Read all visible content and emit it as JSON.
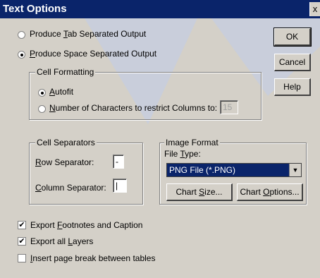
{
  "dialog": {
    "title": "Text Options",
    "close_glyph": "x"
  },
  "output": {
    "tab_label_pre": "Produce ",
    "tab_label_u": "T",
    "tab_label_post": "ab Separated Output",
    "space_label_u": "P",
    "space_label_post": "roduce Space Separated Output",
    "selected": "space"
  },
  "buttons": {
    "ok": "OK",
    "cancel": "Cancel",
    "help": "Help"
  },
  "cell_formatting": {
    "title": "Cell Formatting",
    "autofit_u": "A",
    "autofit_post": "utofit",
    "numchars_u": "N",
    "numchars_post": "umber of Characters to restrict Columns to:",
    "numchars_value": "15",
    "selected": "autofit"
  },
  "cell_separators": {
    "title": "Cell Separators",
    "row_u": "R",
    "row_post": "ow Separator:",
    "row_value": "-",
    "col_u": "C",
    "col_post": "olumn Separator:",
    "col_value": "|"
  },
  "image_format": {
    "title": "Image Format",
    "file_type_pre": "File ",
    "file_type_u": "T",
    "file_type_post": "ype:",
    "selected_type": "PNG File (*.PNG)",
    "chart_size_pre": "Chart ",
    "chart_size_u": "S",
    "chart_size_post": "ize...",
    "chart_options_pre": "Chart ",
    "chart_options_u": "O",
    "chart_options_post": "ptions..."
  },
  "options": {
    "footnotes_pre": "Export ",
    "footnotes_u": "F",
    "footnotes_post": "ootnotes and Caption",
    "footnotes_checked": true,
    "layers_pre": "Export all ",
    "layers_u": "L",
    "layers_post": "ayers",
    "layers_checked": true,
    "pagebreak_u": "I",
    "pagebreak_post": "nsert page break between tables",
    "pagebreak_checked": false,
    "check_glyph": "✔"
  },
  "colors": {
    "titlebar": "#0a246a",
    "face": "#d4d0c8",
    "watermark": "#c7cede"
  }
}
